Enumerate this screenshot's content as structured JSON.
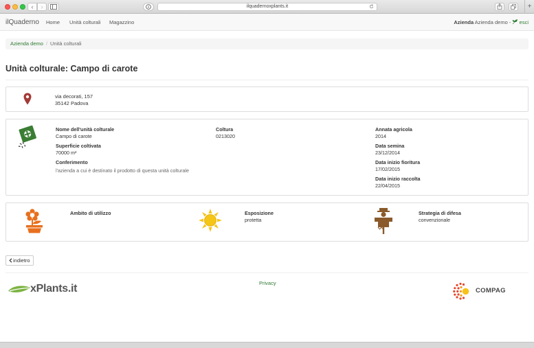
{
  "browser": {
    "url": "ilquadernoxplants.it",
    "back_icon": "‹",
    "forward_icon": "›",
    "new_tab_icon": "+"
  },
  "navbar": {
    "brand": "ilQuaderno",
    "links": [
      "Home",
      "Unità colturali",
      "Magazzino"
    ],
    "user_label": "Azienda",
    "user_name": "Azienda demo -",
    "logout": "esci"
  },
  "breadcrumb": {
    "root": "Azienda demo",
    "separator": "/",
    "current": "Unità colturali"
  },
  "page": {
    "title": "Unità colturale: Campo di carote"
  },
  "address": {
    "street": "via decorati, 157",
    "city": "35142 Padova"
  },
  "details": {
    "nome_label": "Nome dell'unità colturale",
    "nome_value": "Campo di carote",
    "superficie_label": "Superficie coltivata",
    "superficie_value": "70000 m²",
    "conferimento_label": "Conferimento",
    "conferimento_value": "l'azienda a cui è destinato il prodotto di questa unità colturale",
    "coltura_label": "Coltura",
    "coltura_value": "0213020",
    "annata_label": "Annata agricola",
    "annata_value": "2014",
    "semina_label": "Data semina",
    "semina_value": "23/12/2014",
    "fioritura_label": "Data inizio fioritura",
    "fioritura_value": "17/02/2015",
    "raccolta_label": "Data inizio raccolta",
    "raccolta_value": "22/04/2015"
  },
  "environment": {
    "ambito_label": "Ambito di utilizzo",
    "esposizione_label": "Esposizione",
    "esposizione_value": "protetta",
    "strategia_label": "Strategia di difesa",
    "strategia_value": "convenzionale"
  },
  "actions": {
    "back_label": "indietro"
  },
  "footer": {
    "privacy": "Privacy",
    "xplants_logo": "xPlants.it",
    "compag_logo": "COMPAG"
  },
  "colors": {
    "accent_green": "#2f7a32",
    "map_pin": "#a33a35",
    "seed_packet": "#3a7d33",
    "flower_orange": "#e8701e",
    "sun_yellow": "#f5c518",
    "scarecrow_brown": "#8a5a2b"
  }
}
